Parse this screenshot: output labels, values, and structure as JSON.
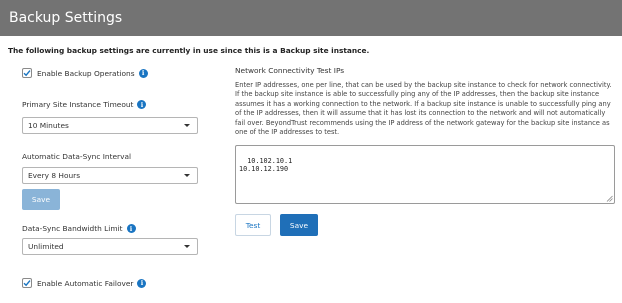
{
  "header": {
    "title": "Backup Settings"
  },
  "notice": "The following backup settings are currently in use since this is a Backup site instance.",
  "enable_backup": {
    "label": "Enable Backup Operations",
    "checked": true,
    "info_icon": "info-icon"
  },
  "primary_timeout": {
    "label": "Primary Site Instance Timeout",
    "value": "10 Minutes",
    "info_icon": "info-icon"
  },
  "sync_interval": {
    "label": "Automatic Data-Sync Interval",
    "value": "Every 8 Hours"
  },
  "save_light_label": "Save",
  "bandwidth": {
    "label": "Data-Sync Bandwidth Limit",
    "value": "Unlimited",
    "info_icon": "info-icon"
  },
  "enable_failover": {
    "label": "Enable Automatic Failover",
    "checked": true,
    "info_icon": "info-icon"
  },
  "connectivity": {
    "title": "Network Connectivity Test IPs",
    "description": "Enter IP addresses, one per line, that can be used by the backup site instance to check for network connectivity. If the backup site instance is able to successfully ping any of the IP addresses, then the backup site instance assumes it has a working connection to the network. If a backup site instance is unable to successfully ping any of the IP addresses, then it will assume that it has lost its connection to the network and will not automatically fail over. BeyondTrust recommends using the IP address of the network gateway for the backup site instance as one of the IP addresses to test.",
    "ips": "10.102.10.1\n10.10.12.190",
    "test_label": "Test",
    "save_label": "Save"
  },
  "colors": {
    "header_bg": "#737373",
    "accent": "#1f6fb8",
    "save_disabled": "#8ab4d8",
    "info": "#1a75c2"
  }
}
